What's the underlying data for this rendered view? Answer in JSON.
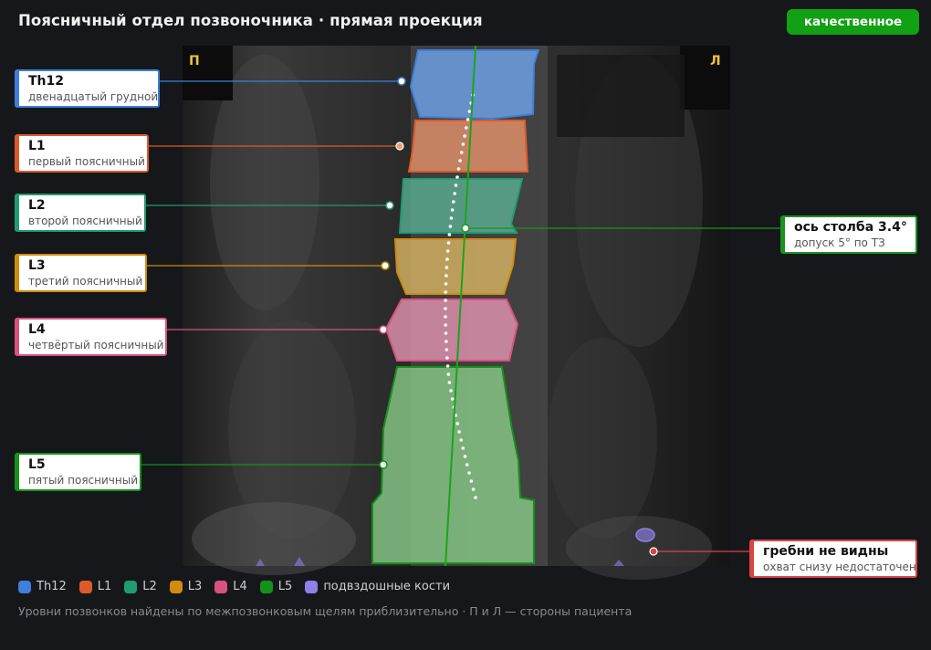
{
  "header": {
    "title": "Поясничный отдел позвоночника · прямая проекция",
    "quality_badge": "качественное"
  },
  "image": {
    "side_left_marker": "П",
    "side_right_marker": "Л"
  },
  "vertebrae": [
    {
      "id": "th12",
      "label": "Th12",
      "description": "двенадцатый грудной",
      "color": "#3d7fd9"
    },
    {
      "id": "l1",
      "label": "L1",
      "description": "первый поясничный",
      "color": "#dd5a2b"
    },
    {
      "id": "l2",
      "label": "L2",
      "description": "второй поясничный",
      "color": "#1f9c71"
    },
    {
      "id": "l3",
      "label": "L3",
      "description": "третий поясничный",
      "color": "#d18b0e"
    },
    {
      "id": "l4",
      "label": "L4",
      "description": "четвёртый поясничный",
      "color": "#d7537e"
    },
    {
      "id": "l5",
      "label": "L5",
      "description": "пятый поясничный",
      "color": "#15911a"
    }
  ],
  "axis_callout": {
    "title": "ось столба 3.4°",
    "subtitle": "допуск 5° по ТЗ",
    "color": "#19941f"
  },
  "iliac_callout": {
    "title": "гребни не видны",
    "subtitle": "охват снизу недостаточен",
    "color": "#d94545"
  },
  "legend": [
    {
      "label": "Th12",
      "color": "#3d7fd9"
    },
    {
      "label": "L1",
      "color": "#dd5a2b"
    },
    {
      "label": "L2",
      "color": "#1f9c71"
    },
    {
      "label": "L3",
      "color": "#d18b0e"
    },
    {
      "label": "L4",
      "color": "#d7537e"
    },
    {
      "label": "L5",
      "color": "#15911a"
    },
    {
      "label": "подвздошные кости",
      "color": "#8e80e6"
    }
  ],
  "footnote": "Уровни позвонков найдены по межпозвонковым щелям приблизительно · П и Л — стороны пациента"
}
